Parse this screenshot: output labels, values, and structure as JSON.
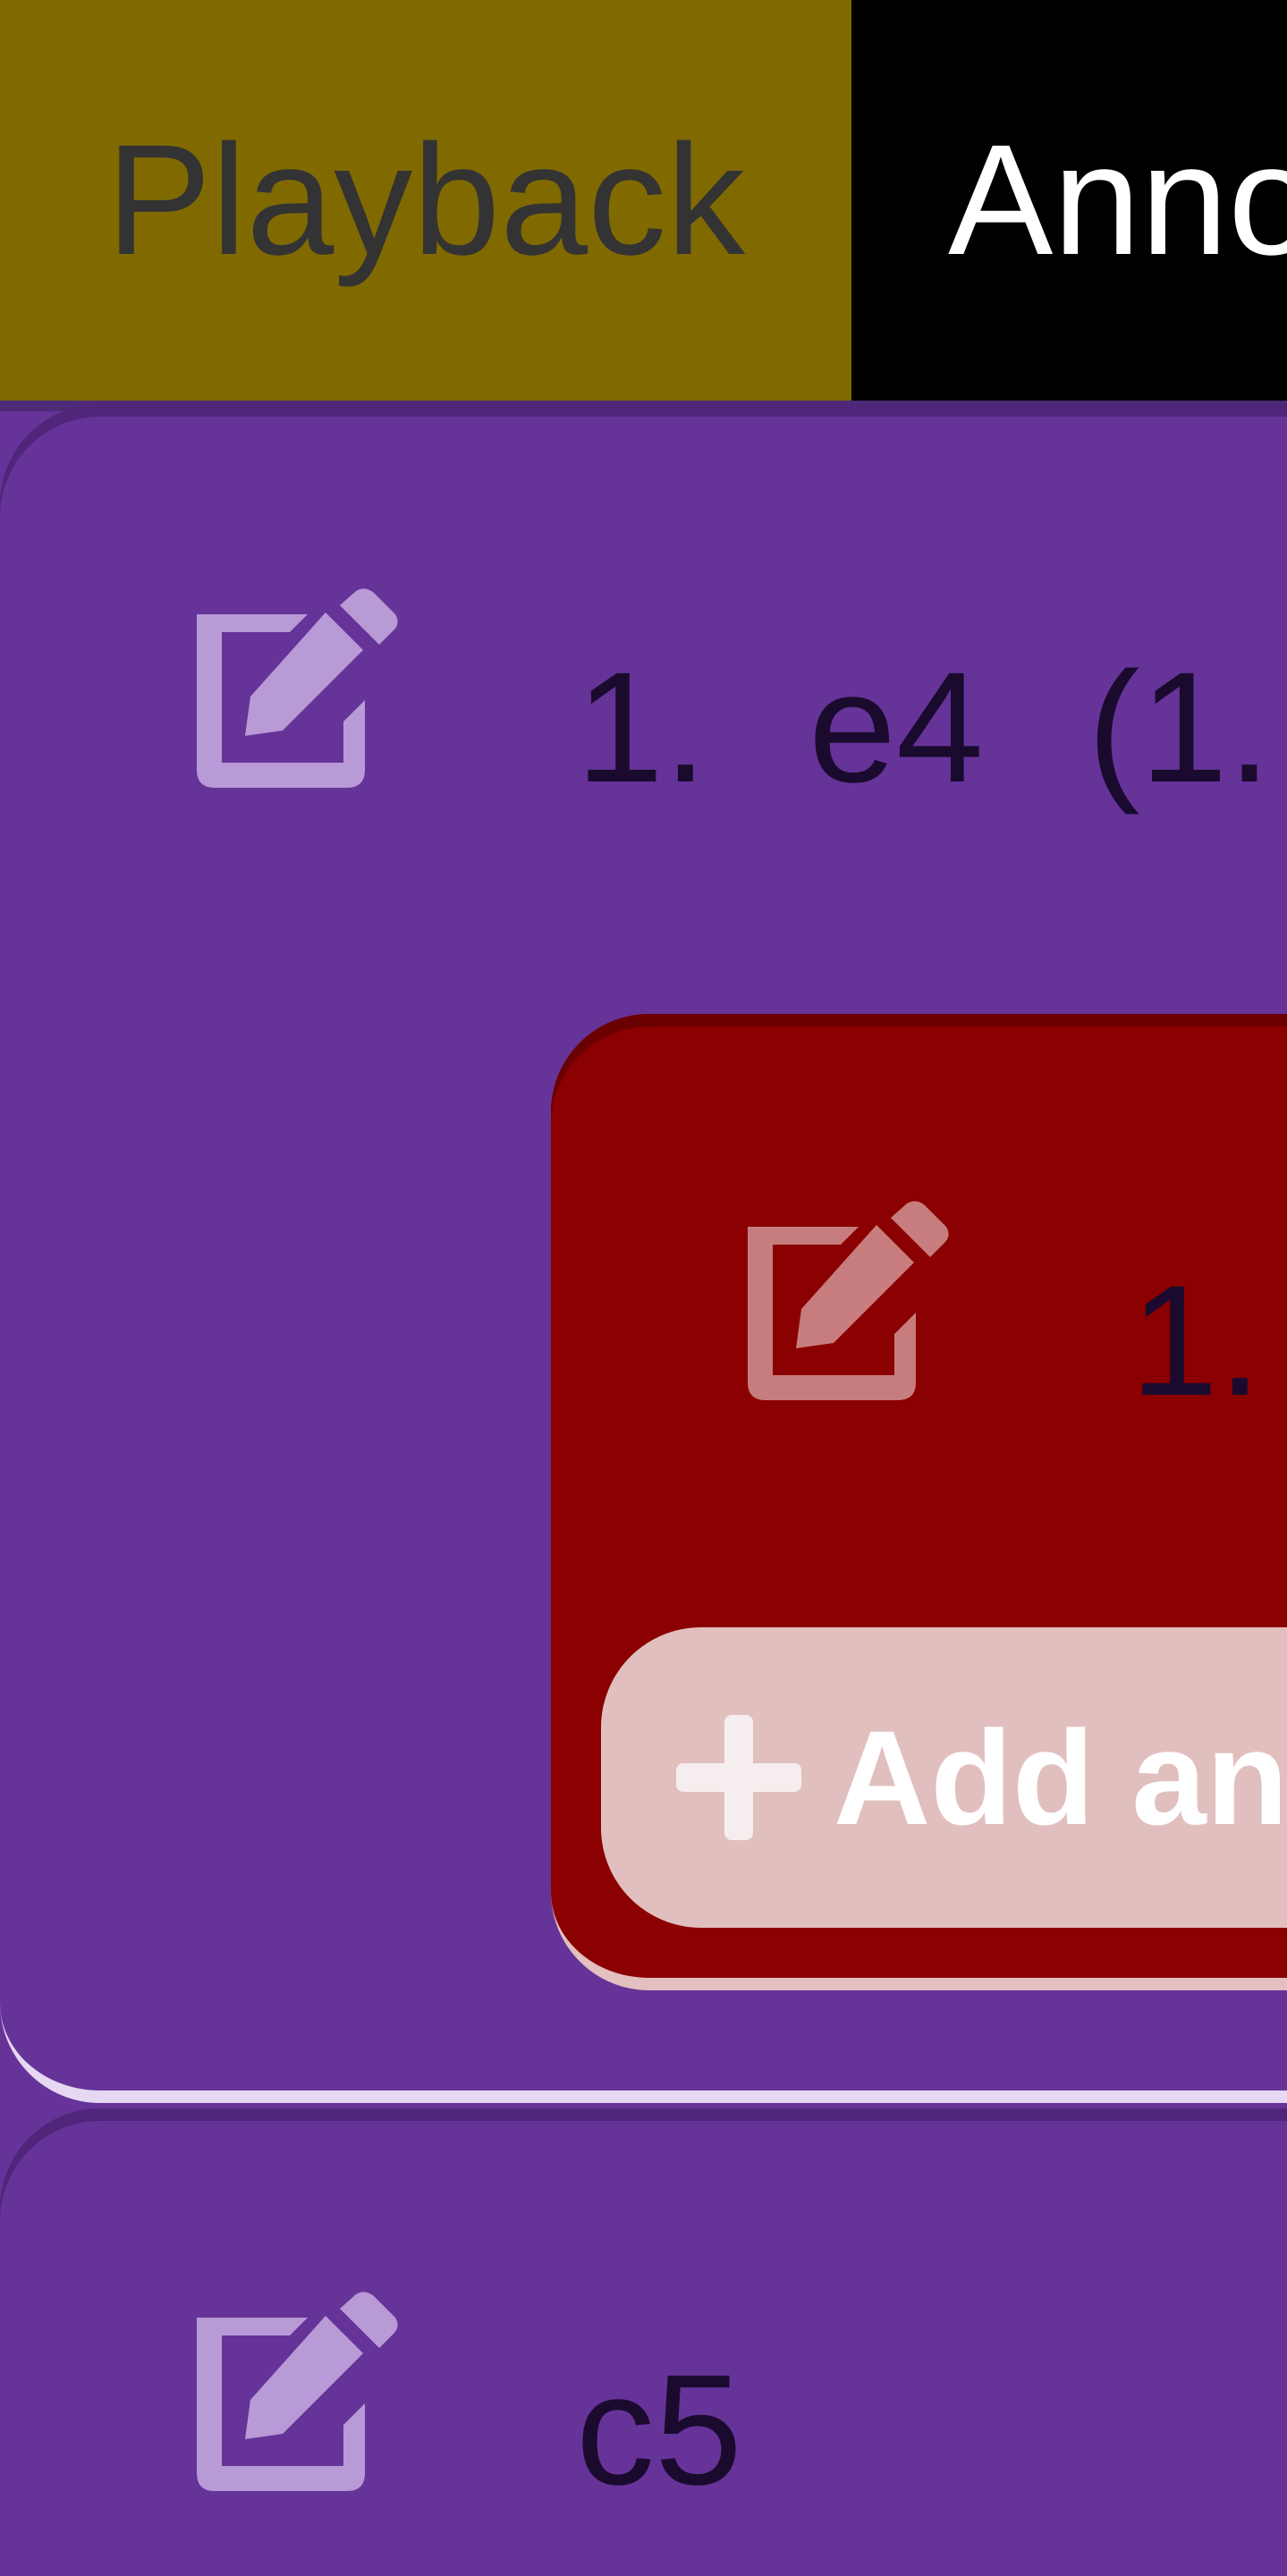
{
  "tabs": [
    {
      "label": "Playback",
      "color": "#806a00",
      "text_color": "#333333"
    },
    {
      "label": "Anno",
      "color": "#000000",
      "text_color": "#ffffff"
    }
  ],
  "moves": {
    "first": {
      "number": "1.",
      "san": "e4",
      "variation_open": "(1."
    },
    "variation": {
      "number": "1."
    },
    "second": {
      "san": "c5"
    }
  },
  "add_button": {
    "label": "Add an",
    "icon": "plus-icon"
  },
  "icons": {
    "edit": "edit-icon"
  },
  "colors": {
    "background": "#663399",
    "variation_card": "#8b0000",
    "add_button": "#e2bfbf"
  }
}
